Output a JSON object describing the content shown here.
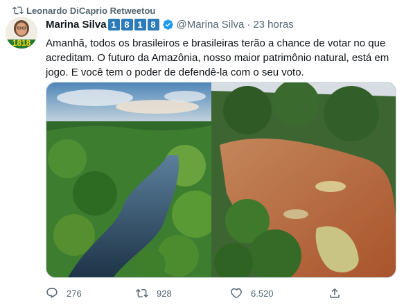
{
  "retweet": {
    "label": "Leonardo DiCaprio Retweetou"
  },
  "avatar": {
    "badge": "1818"
  },
  "author": {
    "name": "Marina Silva",
    "number_badges": [
      "1",
      "8",
      "1",
      "8"
    ],
    "handle": "@Marina Silva",
    "separator": "·",
    "time": "23 horas"
  },
  "tweet": {
    "text": "Amanhã, todos os brasileiros e brasileiras terão a chance de votar no que acreditam. O futuro da Amazônia, nosso maior patrimônio natural, está em jogo. E você tem o poder de defendê-la com o seu voto."
  },
  "actions": {
    "reply_count": "276",
    "retweet_count": "928",
    "like_count": "6.520"
  },
  "colors": {
    "text_primary": "#0f1419",
    "text_secondary": "#536471",
    "verified": "#1d9bf0",
    "number_badge": "#2e7bb9",
    "badge_green": "#1f7a2e"
  },
  "icons": [
    "retweet-icon",
    "verified-icon",
    "reply-icon",
    "retweet-icon",
    "like-icon",
    "share-icon"
  ]
}
